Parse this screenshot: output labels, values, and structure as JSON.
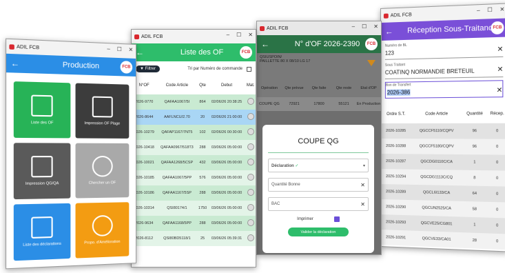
{
  "app_title": "ADIL FCB",
  "win1": {
    "title": "Production",
    "tiles": [
      {
        "label": "Liste des OF",
        "color": "#27b357"
      },
      {
        "label": "Impression OF Plage",
        "color": "#3c3c3c"
      },
      {
        "label": "Impression QG/QA",
        "color": "#5a5a5a"
      },
      {
        "label": "Chercher un OF",
        "color": "#a9a9a9"
      },
      {
        "label": "Liste des déclarations",
        "color": "#2b8ee6"
      },
      {
        "label": "Propo. d'Amélioration",
        "color": "#f39c12"
      }
    ]
  },
  "win2": {
    "title": "Liste des OF",
    "filter_label": "Filtrer",
    "sort_label": "Tri par Numéro de commande",
    "columns": [
      "N°OF",
      "Code Article",
      "Qte",
      "Debut",
      "Mat."
    ],
    "rows": [
      [
        "2026-9770",
        "QAFAA1067/5I",
        "864",
        "02/06/26 20:38:25"
      ],
      [
        "2026-8644",
        "AAFLNCU/2.70",
        "20",
        "02/06/26 21:00:00"
      ],
      [
        "2026-10279",
        "QAFAP1167/7NT5",
        "102",
        "02/06/26 00:30:00"
      ],
      [
        "2026-10418",
        "QAFAA0967/518T3",
        "288",
        "03/06/26 05:00:00"
      ],
      [
        "2026-10021",
        "QAFAA1268/5CSP",
        "432",
        "03/06/26 05:00:00"
      ],
      [
        "2026-10185",
        "QAFAA1067/5PP",
        "576",
        "03/06/26 05:00:00"
      ],
      [
        "2026-10186",
        "QAFAA1167/5SP",
        "288",
        "03/06/26 05:00:00"
      ],
      [
        "2026-10314",
        "QSI80174/1",
        "1750",
        "03/06/26 05:00:00"
      ],
      [
        "2026-9634",
        "QAFAA1168/5PP",
        "288",
        "03/06/26 05:00:00"
      ],
      [
        "2026-8112",
        "QSI80BD5118/1",
        "25",
        "03/06/26 05:39:31"
      ]
    ]
  },
  "win3": {
    "title": "N° d'OF 2026-2390",
    "meta_line1": "QSIUSPOIN/",
    "meta_line2": "PAILLETTE 80 X 08/10 LG 17",
    "columns": [
      "Opération",
      "Qte prévue",
      "Qte faite",
      "Qte reste",
      "Etat d'OP"
    ],
    "row": [
      "COUPE QG",
      "72921",
      "17800",
      "55121",
      "En Production"
    ],
    "dialog": {
      "title": "COUPE QG",
      "declaration_label": "Déclaration",
      "qty_placeholder": "Quantité Bonne",
      "bac_value": "BAC",
      "print_label": "Imprimer",
      "validate_label": "Valider la déclaration"
    }
  },
  "win4": {
    "title": "Réception Sous-Traitance",
    "fields": [
      {
        "label": "Numéro de BL",
        "value": "123"
      },
      {
        "label": "Sous Traitant",
        "value": "COATINQ NORMANDIE BRETEUIL"
      },
      {
        "label": "Bon de Transfert",
        "value": "2026-386"
      }
    ],
    "columns": [
      "Ordre S.T.",
      "Code Article",
      "Quantité",
      "Récep."
    ],
    "rows": [
      [
        "2026-10285",
        "QGCCF5110/CQPV",
        "96",
        "0"
      ],
      [
        "2026-10288",
        "QGCCF5180/CQPV",
        "96",
        "0"
      ],
      [
        "2026-10287",
        "QGCDG0110C/CA",
        "1",
        "0"
      ],
      [
        "2026-10294",
        "QGCDG1113C/CQ",
        "8",
        "0"
      ],
      [
        "2026-10289",
        "QGCL6I133/CA",
        "64",
        "0"
      ],
      [
        "2026-10290",
        "QGCUN2525/CA",
        "58",
        "0"
      ],
      [
        "2026-10293",
        "QGCVE25/CG801",
        "1",
        "0"
      ],
      [
        "2026-10291",
        "QGCVE33/CA01",
        "28",
        "0"
      ]
    ]
  }
}
